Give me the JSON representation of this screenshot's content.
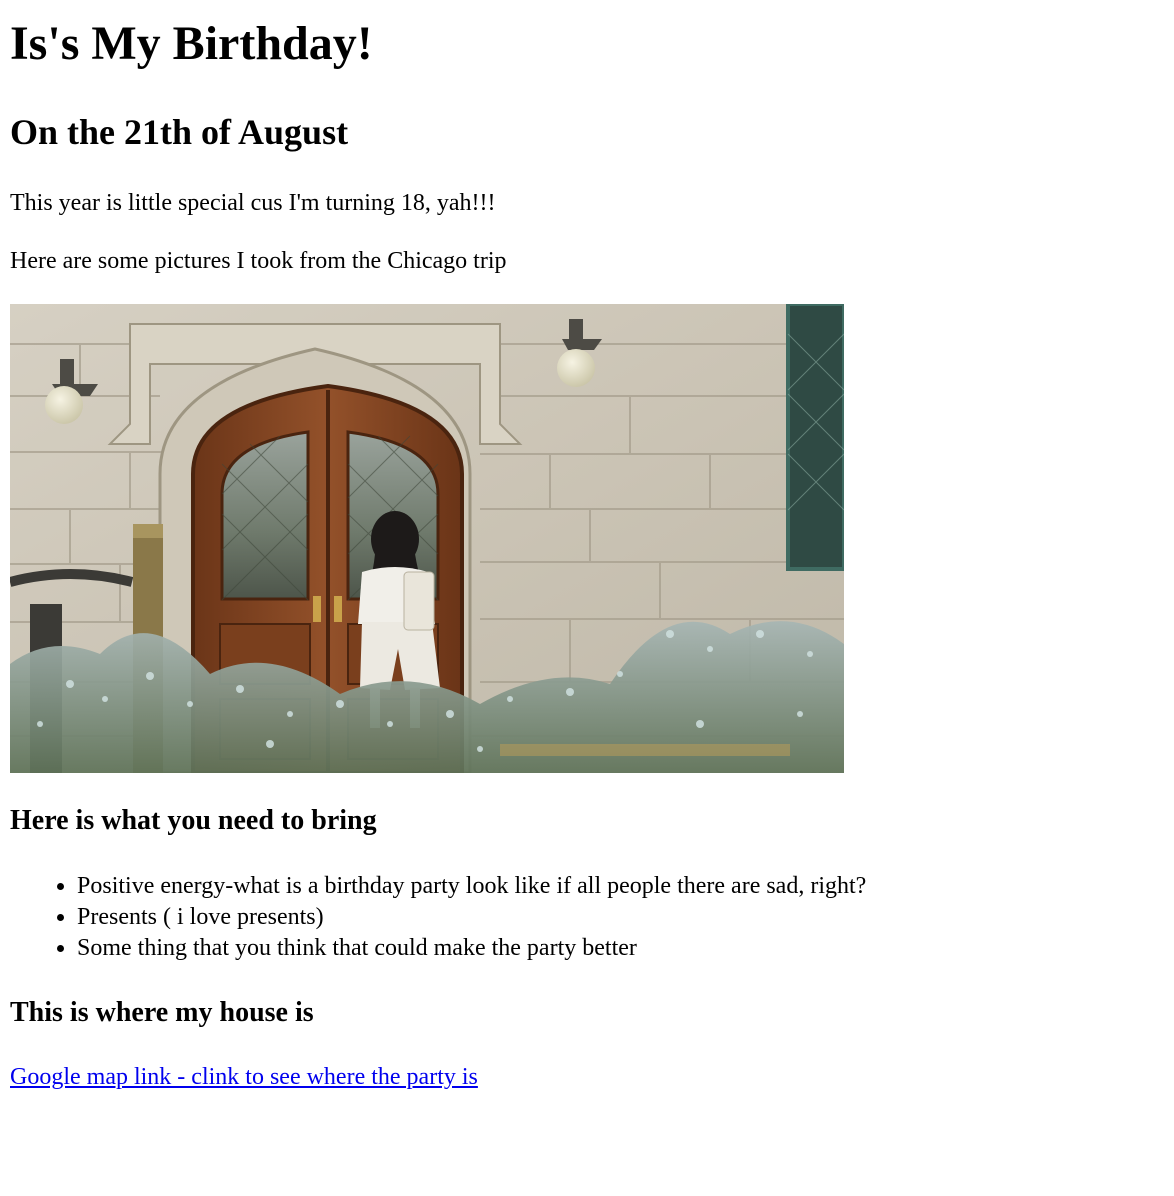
{
  "header": {
    "title": "Is's My Birthday!",
    "subtitle": "On the 21th of August"
  },
  "intro": {
    "line1": "This year is little special cus I'm turning 18, yah!!!",
    "line2": "Here are some pictures I took from the Chicago trip"
  },
  "photo": {
    "subject": "woman in white outfit at wooden arched double doors of a stone building with flowers in foreground"
  },
  "bring": {
    "heading": "Here is what you need to bring",
    "items": [
      "Positive energy-what is a birthday party look like if all people there are sad, right?",
      "Presents ( i love presents)",
      "Some thing that you think that could make the party better"
    ]
  },
  "house": {
    "heading": "This is where my house is",
    "link_text": "Google map link - clink to see where the party is"
  },
  "colors": {
    "link": "#0000ee",
    "text": "#000000",
    "background": "#ffffff"
  }
}
